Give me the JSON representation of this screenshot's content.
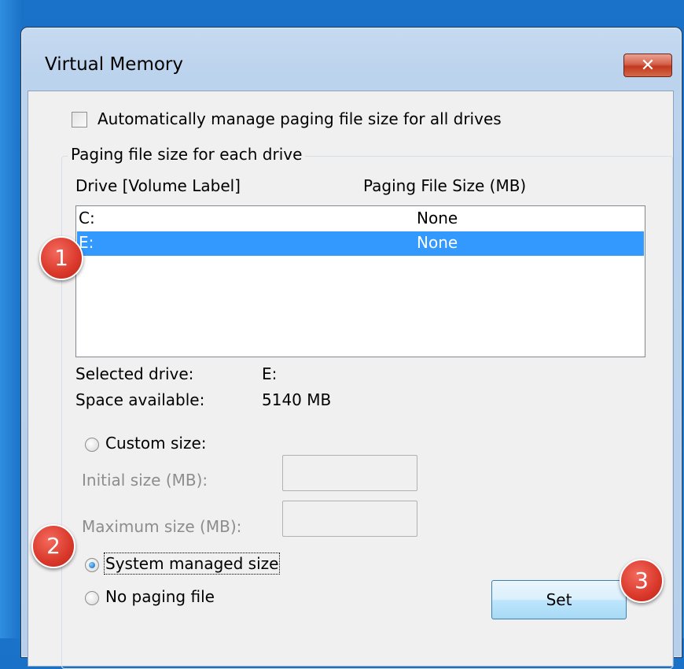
{
  "window": {
    "title": "Virtual Memory",
    "close_label": "✕"
  },
  "auto_manage": {
    "label": "Automatically manage paging file size for all drives",
    "checked": false
  },
  "group": {
    "title": "Paging file size for each drive",
    "col_drive": "Drive  [Volume Label]",
    "col_size": "Paging File Size (MB)"
  },
  "drives": [
    {
      "drive": "C:",
      "size": "None",
      "selected": false
    },
    {
      "drive": "E:",
      "size": "None",
      "selected": true
    }
  ],
  "selected_drive": {
    "label": "Selected drive:",
    "value": "E:"
  },
  "space_available": {
    "label": "Space available:",
    "value": "5140 MB"
  },
  "custom_size": {
    "label": "Custom size:",
    "selected": false
  },
  "initial_size": {
    "label": "Initial size (MB):",
    "value": ""
  },
  "maximum_size": {
    "label": "Maximum size (MB):",
    "value": ""
  },
  "system_managed": {
    "label": "System managed size",
    "selected": true
  },
  "no_paging": {
    "label": "No paging file",
    "selected": false
  },
  "set_button": {
    "label": "Set"
  },
  "badges": [
    "1",
    "2",
    "3"
  ],
  "colors": {
    "selection": "#3399ff",
    "badge": "#d9382a",
    "desktop": "#1a6fc4"
  }
}
